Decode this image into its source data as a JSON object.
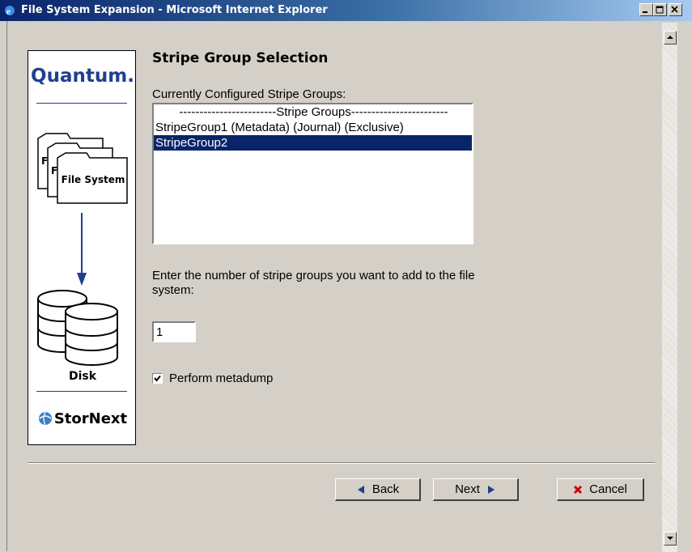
{
  "window": {
    "title": "File System Expansion - Microsoft Internet Explorer"
  },
  "sidebar": {
    "brand": "Quantum.",
    "folder_label": "File System",
    "disk_label": "Disk",
    "product": "StorNext"
  },
  "main": {
    "heading": "Stripe Group Selection",
    "list_label": "Currently Configured Stripe Groups:",
    "stripe_groups": [
      "------------------------Stripe Groups------------------------",
      "StripeGroup1 (Metadata) (Journal) (Exclusive)",
      "StripeGroup2"
    ],
    "selected_group": "StripeGroup2",
    "count_prompt_line1": "Enter the number of stripe groups you want to add to the file",
    "count_prompt_line2": "system:",
    "count_value": "1",
    "metadump_label": "Perform metadump",
    "metadump_checked": true
  },
  "buttons": {
    "back": "Back",
    "next": "Next",
    "cancel": "Cancel"
  },
  "colors": {
    "title_bar": "#0a246a",
    "selection": "#0a246a",
    "brand": "#1f3f8f",
    "cancel_x": "#cc0000",
    "arrow": "#1f3f8f"
  }
}
